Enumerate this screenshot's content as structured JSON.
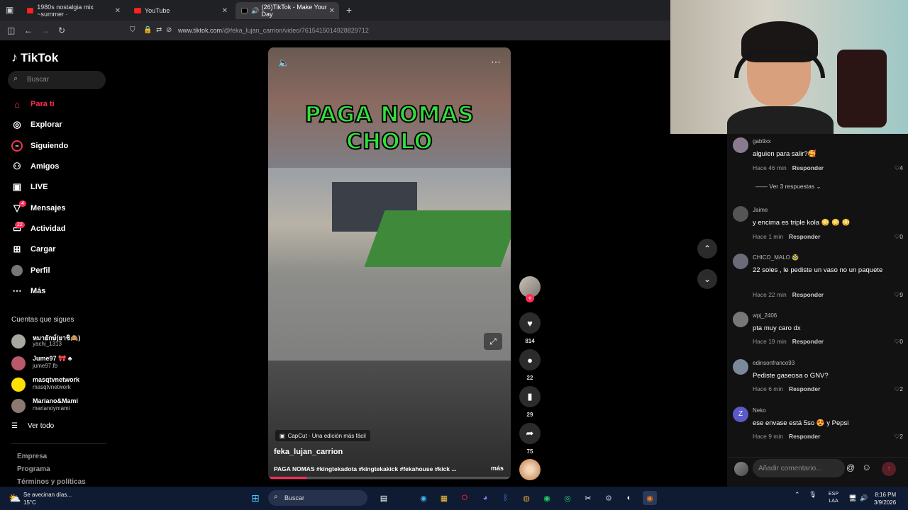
{
  "browser": {
    "tabs": [
      {
        "label": "1980s nostalgia mix ~summer ·",
        "favicon_color": "#ff2020",
        "active": false
      },
      {
        "label": "YouTube",
        "favicon_color": "#ff2020",
        "active": false
      },
      {
        "label": "(26)TikTok - Make Your Day",
        "favicon_color": "#000000",
        "active": true
      }
    ],
    "new_tab": "+",
    "url_domain": "www.tiktok.com",
    "url_path": "/@feka_lujan_carrion/video/7615415014928829712"
  },
  "sidebar": {
    "logo": "TikTok",
    "search_placeholder": "Buscar",
    "nav": [
      {
        "label": "Para ti",
        "icon": "home-icon",
        "active": true
      },
      {
        "label": "Explorar",
        "icon": "compass-icon"
      },
      {
        "label": "Siguiendo",
        "icon": "following-icon"
      },
      {
        "label": "Amigos",
        "icon": "friends-icon"
      },
      {
        "label": "LIVE",
        "icon": "live-icon"
      },
      {
        "label": "Mensajes",
        "icon": "messages-icon",
        "badge": "4"
      },
      {
        "label": "Actividad",
        "icon": "activity-icon",
        "badge": "22"
      },
      {
        "label": "Cargar",
        "icon": "upload-icon"
      },
      {
        "label": "Perfil",
        "icon": "profile-icon"
      },
      {
        "label": "Más",
        "icon": "more-icon"
      }
    ],
    "following_title": "Cuentas que sigues",
    "accounts": [
      {
        "name": "หมายักษ์(ยาชิ🙈)",
        "handle": "yachi_1313",
        "color": "#a8a8a0"
      },
      {
        "name": "Jume97 🎀 ♣",
        "handle": "jume97.fb",
        "color": "#b85a6a"
      },
      {
        "name": "masqtvnetwork",
        "handle": "masqtvnetwork",
        "color": "#ffe000"
      },
      {
        "name": "Mariano&Mami",
        "handle": "marianoymami",
        "color": "#8a7a70"
      }
    ],
    "see_all": "Ver todo",
    "footer_links": [
      "Empresa",
      "Programa",
      "Términos y políticas"
    ]
  },
  "video": {
    "overlay_line1": "PAGA NOMAS",
    "overlay_line2": "CHOLO",
    "capcut": "CapCut · Una edición más fácil",
    "author": "feka_lujan_carrion",
    "description": "PAGA NOMAS #kingtekadota #kingtekakick #fekahouse #kick ...",
    "more": "más",
    "progress": 0.16
  },
  "actions": {
    "likes": "814",
    "comments": "22",
    "saves": "29",
    "shares": "75"
  },
  "comments": {
    "replies_label": "Ver 3 respuestas",
    "reply_label": "Responder",
    "items": [
      {
        "user": "gab9xx",
        "text": "alguien para salir?🥰",
        "time": "Hace 46 min",
        "likes": "4",
        "color": "#8a7a90"
      },
      {
        "user": "Jaime",
        "text": "y encima es triple kola 😳 😳 😳",
        "time": "Hace 1 min",
        "likes": "0",
        "color": "#555"
      },
      {
        "user": "CHICO_MALO 🥸",
        "text": "22 soles , le pediste un vaso no un paquete",
        "time": "Hace 22 min",
        "likes": "9",
        "color": "#6a6a78"
      },
      {
        "user": "wpj_2406",
        "text": "pta muy caro dx",
        "time": "Hace 19 min",
        "likes": "0",
        "color": "#777"
      },
      {
        "user": "edinsonfranco93",
        "text": "Pediste gaseosa o GNV?",
        "time": "Hace 6 min",
        "likes": "2",
        "color": "#7a8a9a"
      },
      {
        "user": "Neko",
        "text": "ese envase está 5so 😍 y Pepsi",
        "time": "Hace 9 min",
        "likes": "2",
        "color": "#5a5ac8",
        "initial": "Z"
      }
    ],
    "input_placeholder": "Añadir comentario..."
  },
  "taskbar": {
    "weather_line1": "Se avecinan días...",
    "weather_line2": "15°C",
    "search_placeholder": "Buscar",
    "lang_line1": "ESP",
    "lang_line2": "LAA",
    "time": "8:16 PM",
    "date": "3/9/2026"
  }
}
